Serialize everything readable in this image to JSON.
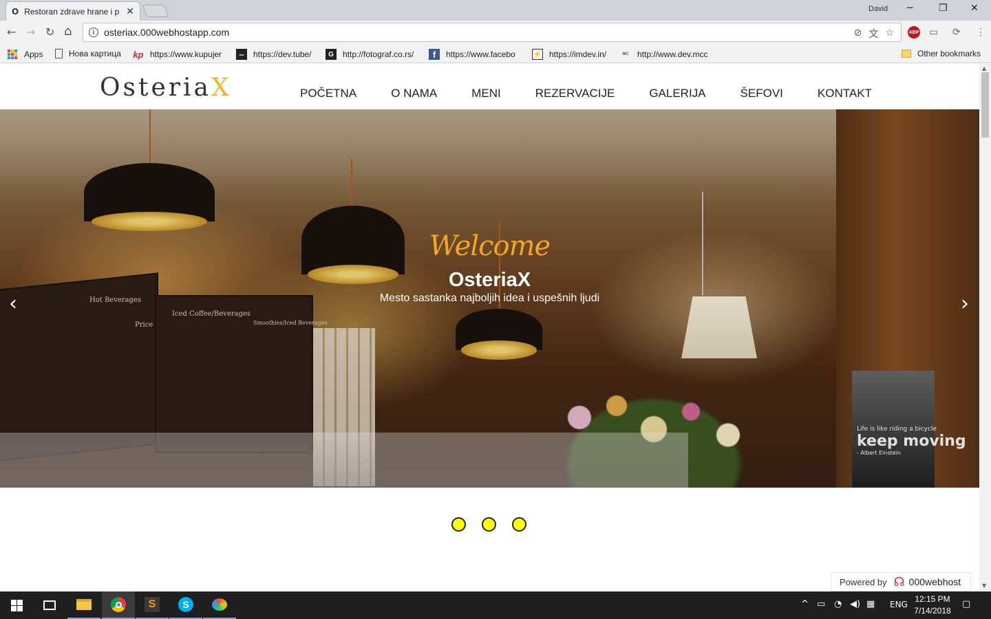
{
  "browser": {
    "tab_title": "Restoran zdrave hrane i p",
    "tab_favicon": "O",
    "tab_close": "✕",
    "user": "David",
    "window_controls": {
      "minimize": "─",
      "maximize": "❐",
      "close": "✕"
    },
    "url": "osteriax.000webhostapp.com",
    "nav": {
      "back": "←",
      "forward": "→",
      "reload": "↻",
      "home": "⌂"
    },
    "omnibox_icons": {
      "blocked_icon": "⊘",
      "translate_icon": "文",
      "star_icon": "☆"
    },
    "extensions": {
      "abp": "ABP",
      "ext2": "▭",
      "sync": "⟳",
      "menu": "⋮"
    },
    "bookmarks": [
      {
        "label": "Apps",
        "icon": "apps-icon"
      },
      {
        "label": "Нова картица",
        "icon": "page-icon"
      },
      {
        "label": "https://www.kupujer",
        "icon": "kp-icon",
        "glyph": "kp"
      },
      {
        "label": "https://dev.tube/",
        "icon": "devtube-icon",
        "glyph": "▬"
      },
      {
        "label": "http://fotograf.co.rs/",
        "icon": "g-icon",
        "glyph": "G"
      },
      {
        "label": "https://www.facebo",
        "icon": "facebook-icon",
        "glyph": "f"
      },
      {
        "label": "https://imdev.in/",
        "icon": "imdev-icon",
        "glyph": "⚡"
      },
      {
        "label": "http://www.dev.mcc",
        "icon": "mcc-icon",
        "glyph": "MC"
      }
    ],
    "other_bookmarks": "Other bookmarks"
  },
  "site": {
    "logo_main": "Osteria",
    "logo_accent": "X",
    "menu": [
      "POČETNA",
      "O NAMA",
      "MENI",
      "REZERVACIJE",
      "GALERIJA",
      "ŠEFOVI",
      "KONTAKT"
    ],
    "hero": {
      "welcome": "Welcome",
      "title": "OsteriaX",
      "subtitle": "Mesto sastanka najboljih idea i uspešnih ljudi",
      "prev": "‹",
      "next": "›",
      "board_title_1": "Hot Beverages",
      "board_title_2": "Iced Coffee/Beverages",
      "board_title_3": "Smoothies/Iced Beverages",
      "board_price": "Price",
      "poster_line1": "Life is like riding a bicycle",
      "poster_line2": "keep moving",
      "poster_author": "- Albert Einstein"
    },
    "carousel_dots": 3,
    "powered_by": "Powered by",
    "powered_brand": "000webhost"
  },
  "taskbar": {
    "tray_lang": "ENG",
    "time": "12:15 PM",
    "date": "7/14/2018"
  },
  "colors": {
    "logo_accent": "#f0b429",
    "welcome": "#f5a623",
    "dot_fill": "#ffff00"
  }
}
